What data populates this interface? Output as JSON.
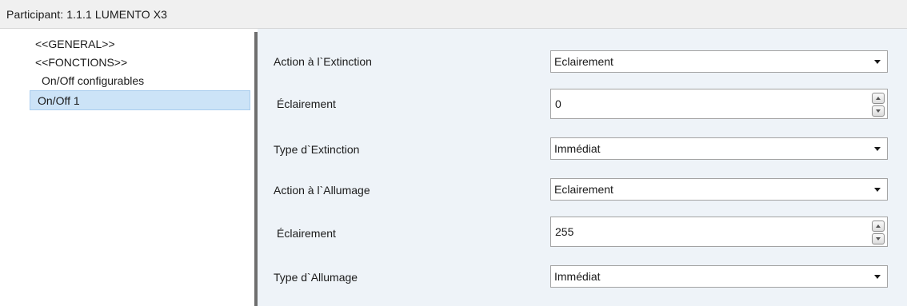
{
  "window": {
    "title": "Participant: 1.1.1  LUMENTO X3"
  },
  "tree": {
    "items": [
      {
        "label": "<<GENERAL>>"
      },
      {
        "label": "<<FONCTIONS>>"
      },
      {
        "label": "On/Off configurables"
      },
      {
        "label": "On/Off 1",
        "selected": true
      }
    ]
  },
  "params": [
    {
      "label": "Action à l`Extinction",
      "type": "dropdown",
      "value": "Eclairement"
    },
    {
      "label": "Éclairement",
      "type": "spinbox",
      "value": "0"
    },
    {
      "label": "Type d`Extinction",
      "type": "dropdown",
      "value": "Immédiat"
    },
    {
      "label": "Action à l`Allumage",
      "type": "dropdown",
      "value": "Eclairement"
    },
    {
      "label": "Éclairement",
      "type": "spinbox",
      "value": "255"
    },
    {
      "label": "Type d`Allumage",
      "type": "dropdown",
      "value": "Immédiat"
    }
  ],
  "colors": {
    "content_bg": "#eef3f8",
    "selection_bg": "#cce3f7",
    "splitter": "#6e6e6e"
  }
}
